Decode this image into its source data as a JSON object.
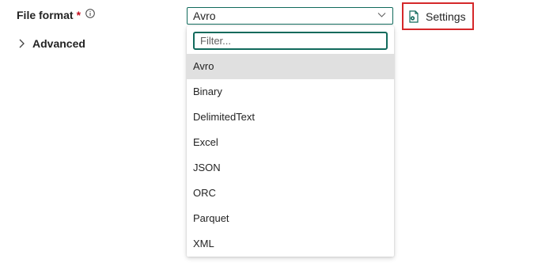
{
  "form": {
    "file_format_label": "File format",
    "required_mark": "*",
    "advanced_label": "Advanced"
  },
  "select": {
    "value": "Avro"
  },
  "settings_button": {
    "label": "Settings"
  },
  "dropdown": {
    "filter_placeholder": "Filter...",
    "options": [
      "Avro",
      "Binary",
      "DelimitedText",
      "Excel",
      "JSON",
      "ORC",
      "Parquet",
      "XML"
    ],
    "selected": "Avro"
  },
  "colors": {
    "accent": "#116a5c",
    "highlight_border": "#d5282a",
    "required": "#c50f1f",
    "selected_bg": "#e0e0e0"
  },
  "icons": {
    "info": "info-icon",
    "advanced_chevron": "chevron-right-icon",
    "select_caret": "chevron-down-icon",
    "settings": "settings-file-icon"
  }
}
